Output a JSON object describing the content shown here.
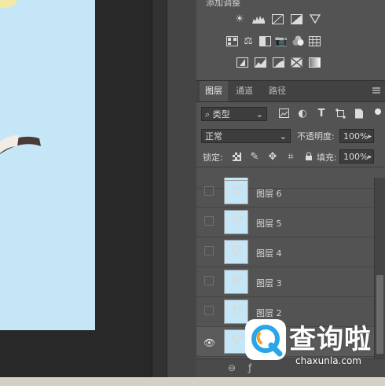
{
  "adjustments": {
    "title": "添加调整",
    "row1_icons": [
      "brightness-icon",
      "levels-icon",
      "curves-icon",
      "exposure-icon"
    ],
    "row2_icons": [
      "vibrance-icon",
      "hue-saturation-icon",
      "color-balance-icon",
      "black-white-icon",
      "photo-filter-icon",
      "channel-mixer-icon"
    ],
    "row3_icons": [
      "invert-icon",
      "posterize-icon",
      "threshold-icon",
      "selective-color-icon",
      "gradient-map-icon"
    ]
  },
  "layers_panel": {
    "tabs": [
      "图层",
      "通道",
      "路径"
    ],
    "active_tab": "图层",
    "filter": {
      "label": "类型"
    },
    "blend_mode": "正常",
    "opacity_label": "不透明度:",
    "opacity_value": "100%",
    "lock_label": "锁定:",
    "fill_label": "填充:",
    "fill_value": "100%",
    "layers": [
      {
        "name": "",
        "visible": false
      },
      {
        "name": "图层 6",
        "visible": false
      },
      {
        "name": "图层 5",
        "visible": false
      },
      {
        "name": "图层 4",
        "visible": false
      },
      {
        "name": "图层 3",
        "visible": false
      },
      {
        "name": "图层 2",
        "visible": false
      },
      {
        "name": "",
        "visible": true
      }
    ]
  },
  "watermark": {
    "title": "查询啦",
    "url": "chaxunla.com"
  }
}
